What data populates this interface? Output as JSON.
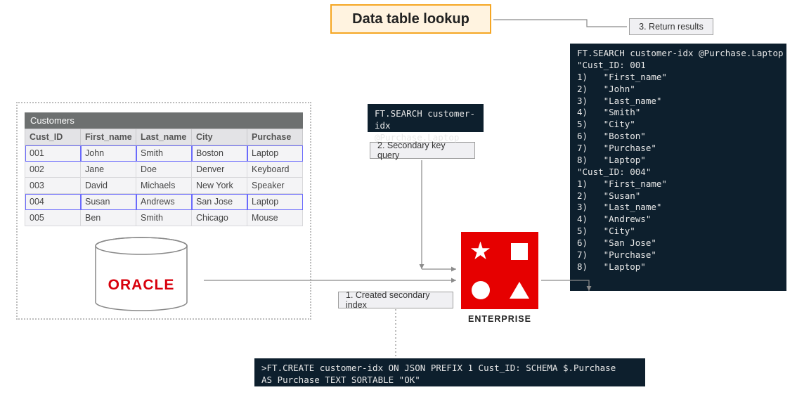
{
  "title": "Data table lookup",
  "steps": {
    "s1": "1. Created secondary index",
    "s2": "2. Secondary key query",
    "s3": "3. Return results"
  },
  "search_cmd": {
    "l1": "FT.SEARCH customer-idx",
    "l2": "@Purchase.Laptop"
  },
  "create_cmd": {
    "l1": ">FT.CREATE customer-idx ON JSON PREFIX 1 Cust_ID: SCHEMA $.Purchase",
    "l2": "AS Purchase TEXT SORTABLE \"OK\""
  },
  "table": {
    "name": "Customers",
    "columns": [
      "Cust_ID",
      "First_name",
      "Last_name",
      "City",
      "Purchase"
    ],
    "rows": [
      {
        "id": "001",
        "first": "John",
        "last": "Smith",
        "city": "Boston",
        "purchase": "Laptop",
        "hl": true
      },
      {
        "id": "002",
        "first": "Jane",
        "last": "Doe",
        "city": "Denver",
        "purchase": "Keyboard",
        "hl": false
      },
      {
        "id": "003",
        "first": "David",
        "last": "Michaels",
        "city": "New York",
        "purchase": "Speaker",
        "hl": false
      },
      {
        "id": "004",
        "first": "Susan",
        "last": "Andrews",
        "city": "San Jose",
        "purchase": "Laptop",
        "hl": true
      },
      {
        "id": "005",
        "first": "Ben",
        "last": "Smith",
        "city": "Chicago",
        "purchase": "Mouse",
        "hl": false
      }
    ]
  },
  "db_label": "ORACLE",
  "redis_label": "ENTERPRISE",
  "results": {
    "header": "FT.SEARCH customer-idx @Purchase.Laptop",
    "records": [
      {
        "cust": "\"Cust_ID: 001",
        "fields": [
          "\"First_name\"",
          "\"John\"",
          "\"Last_name\"",
          "\"Smith\"",
          "\"City\"",
          "\"Boston\"",
          "\"Purchase\"",
          "\"Laptop\""
        ]
      },
      {
        "cust": "\"Cust_ID: 004\"",
        "fields": [
          "\"First_name\"",
          "\"Susan\"",
          "\"Last_name\"",
          "\"Andrews\"",
          "\"City\"",
          "\"San Jose\"",
          "\"Purchase\"",
          "\"Laptop\""
        ]
      }
    ]
  }
}
